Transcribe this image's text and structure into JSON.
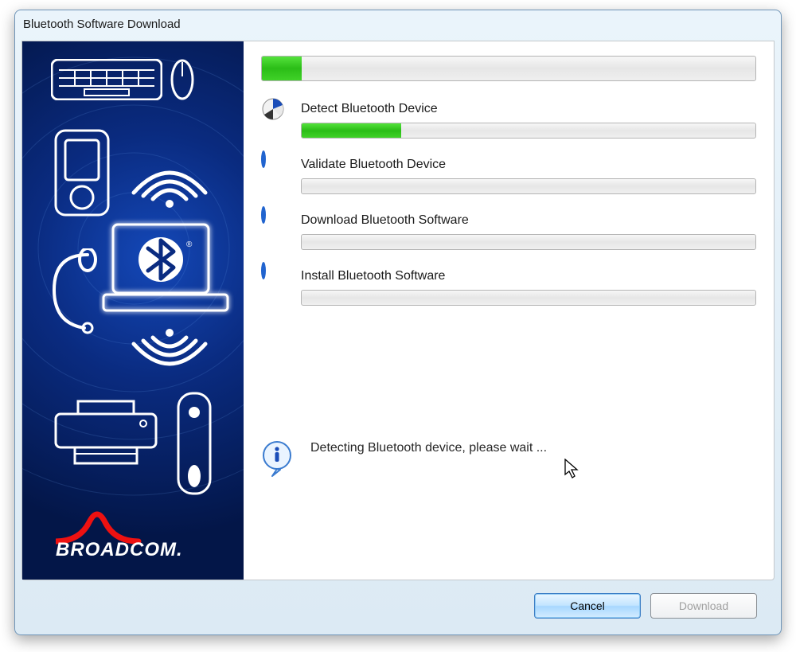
{
  "window": {
    "title": "Bluetooth Software Download"
  },
  "overall_progress_percent": 8,
  "steps": [
    {
      "label": "Detect Bluetooth Device",
      "state": "active",
      "progress_percent": 22
    },
    {
      "label": "Validate Bluetooth Device",
      "state": "pending",
      "progress_percent": 0
    },
    {
      "label": "Download Bluetooth Software",
      "state": "pending",
      "progress_percent": 0
    },
    {
      "label": "Install Bluetooth Software",
      "state": "pending",
      "progress_percent": 0
    }
  ],
  "status_text": "Detecting Bluetooth device, please wait ...",
  "buttons": {
    "cancel": "Cancel",
    "download": "Download"
  },
  "brand": "BROADCOM."
}
